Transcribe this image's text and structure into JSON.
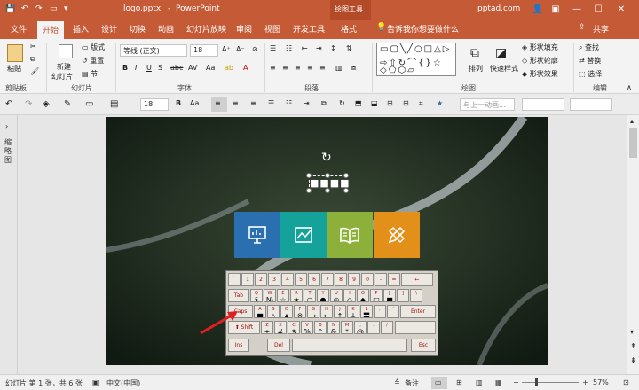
{
  "title_bar": {
    "filename": "logo.pptx",
    "separator": "-",
    "app": "PowerPoint",
    "context_group": "绘图工具",
    "account": "pptad.com"
  },
  "tabs": [
    "文件",
    "开始",
    "插入",
    "设计",
    "切换",
    "动画",
    "幻灯片放映",
    "审阅",
    "视图",
    "开发工具",
    "格式"
  ],
  "active_tab": "开始",
  "tell_me": "告诉我你想要做什么",
  "share": "共享",
  "ribbon": {
    "groups": {
      "clipboard": "剪贴板",
      "slides": "幻灯片",
      "font": "字体",
      "paragraph": "段落",
      "drawing": "绘图",
      "editing": "编辑"
    },
    "paste": "粘贴",
    "new_slide": "新建",
    "new_slide_2": "幻灯片",
    "layout": "版式",
    "reset": "重置",
    "section": "节",
    "font_name": "等线 (正文)",
    "font_size": "18",
    "arrange": "排列",
    "quick_styles": "快速样式",
    "shape_fill": "形状填充",
    "shape_outline": "形状轮廓",
    "shape_effects": "形状效果",
    "find": "查找",
    "replace": "替换",
    "select": "选择"
  },
  "qa_bar": {
    "font_size": "18",
    "animation_placeholder": "与上一动画..."
  },
  "thumb_label": "缩略图",
  "slide": {
    "logo_text": "■■■■",
    "tile_colors": [
      "#2a6fb0",
      "#15a29a",
      "#8cb03a",
      "#e3901a"
    ],
    "tile_icons": [
      "presentation-icon",
      "chart-icon",
      "book-icon",
      "pencil-ruler-icon"
    ]
  },
  "keyboard": {
    "row1_keys": [
      "`",
      "1",
      "2",
      "3",
      "4",
      "5",
      "6",
      "7",
      "8",
      "9",
      "0",
      "-",
      "="
    ],
    "backspace": "←",
    "tab": "Tab",
    "row2_letters": [
      "Q",
      "W",
      "E",
      "R",
      "T",
      "Y",
      "U",
      "I",
      "O",
      "P",
      "[",
      "]",
      "\\"
    ],
    "row2_symbols": [
      "§",
      "№",
      "☆",
      "★",
      "○",
      "●",
      "◎",
      "◇",
      "◆",
      "□",
      "■",
      "",
      ""
    ],
    "caps": "Caps",
    "row3_letters": [
      "A",
      "S",
      "D",
      "F",
      "G",
      "H",
      "J",
      "K",
      "L",
      ";",
      "'"
    ],
    "row3_symbols": [
      "■",
      "△",
      "▲",
      "※",
      "→",
      "←",
      "↑",
      "↓",
      "〓",
      "",
      ""
    ],
    "enter": "Enter",
    "shift": "Shift",
    "row4_letters": [
      "Z",
      "X",
      "C",
      "V",
      "B",
      "N",
      "M",
      ",",
      ".",
      "/"
    ],
    "row4_symbols": [
      "+",
      "#",
      "$",
      "%",
      "^",
      "&",
      "*",
      "@",
      "",
      ""
    ],
    "ins": "Ins",
    "del": "Del",
    "esc": "Esc"
  },
  "status_bar": {
    "slide_info": "幻灯片 第 1 张，共 6 张",
    "language": "中文(中国)",
    "notes": "备注",
    "zoom": "57%"
  }
}
